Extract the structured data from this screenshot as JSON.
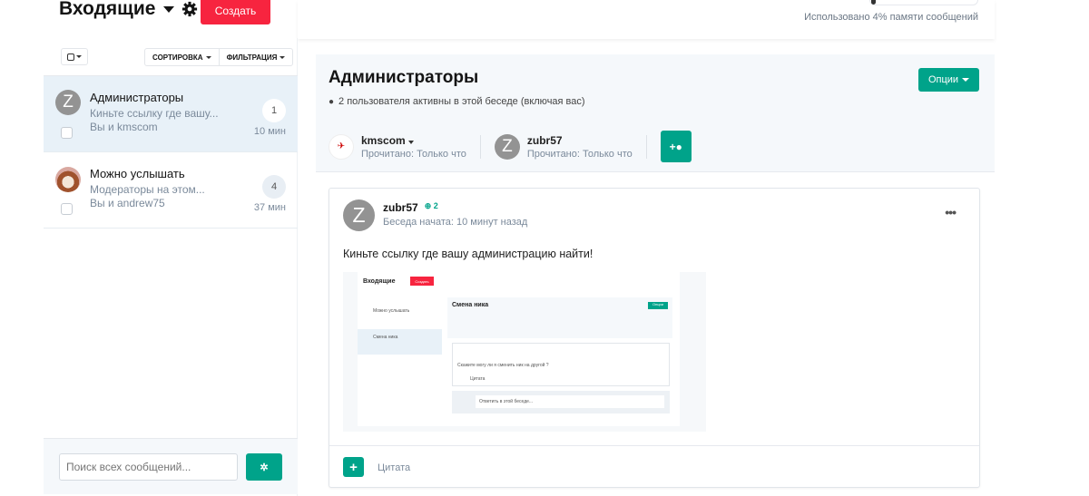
{
  "header": {
    "title": "Входящие",
    "create_label": "Создать",
    "usage_text": "Использовано 4% памяти сообщений",
    "usage_percent": 4
  },
  "filters": {
    "sort_label": "СОРТИРОВКА",
    "filter_label": "ФИЛЬТРАЦИЯ"
  },
  "conversations": [
    {
      "title": "Администраторы",
      "preview": "Киньте ссылку где вашу...",
      "with": "Вы и kmscom",
      "unread": "1",
      "time": "10 мин",
      "avatar_letter": "Z",
      "selected": true
    },
    {
      "title": "Можно услышать",
      "preview": "Модераторы на этом...",
      "with": "Вы и andrew75",
      "unread": "4",
      "time": "37 мин",
      "selected": false
    }
  ],
  "search": {
    "placeholder": "Поиск всех сообщений..."
  },
  "conversation": {
    "title": "Администраторы",
    "options_label": "Опции",
    "active_text": "2 пользователя активны в этой беседе (включая вас)",
    "participants": [
      {
        "name": "kmscom",
        "read": "Прочитано: Только что"
      },
      {
        "name": "zubr57",
        "read": "Прочитано: Только что",
        "avatar_letter": "Z"
      }
    ]
  },
  "message": {
    "author": "zubr57",
    "avatar_letter": "Z",
    "reputation": "2",
    "started": "Беседа начата: 10 минут назад",
    "text": "Киньте ссылку где вашу администрацию найти!",
    "quote_label": "Цитата",
    "screenshot": {
      "title": "Входящие",
      "create": "Создать",
      "conv_title": "Смена ника",
      "options": "Опции",
      "item1": "Можно услышать",
      "item2": "Смена ника",
      "msg": "Скажите могу ли я сменить ник на другой ?",
      "reply": "Ответить в этой беседе...",
      "quote": "Цитата"
    }
  },
  "colors": {
    "accent": "#00a38a",
    "create": "#f7243f",
    "selected_row": "#e8f1f8"
  }
}
